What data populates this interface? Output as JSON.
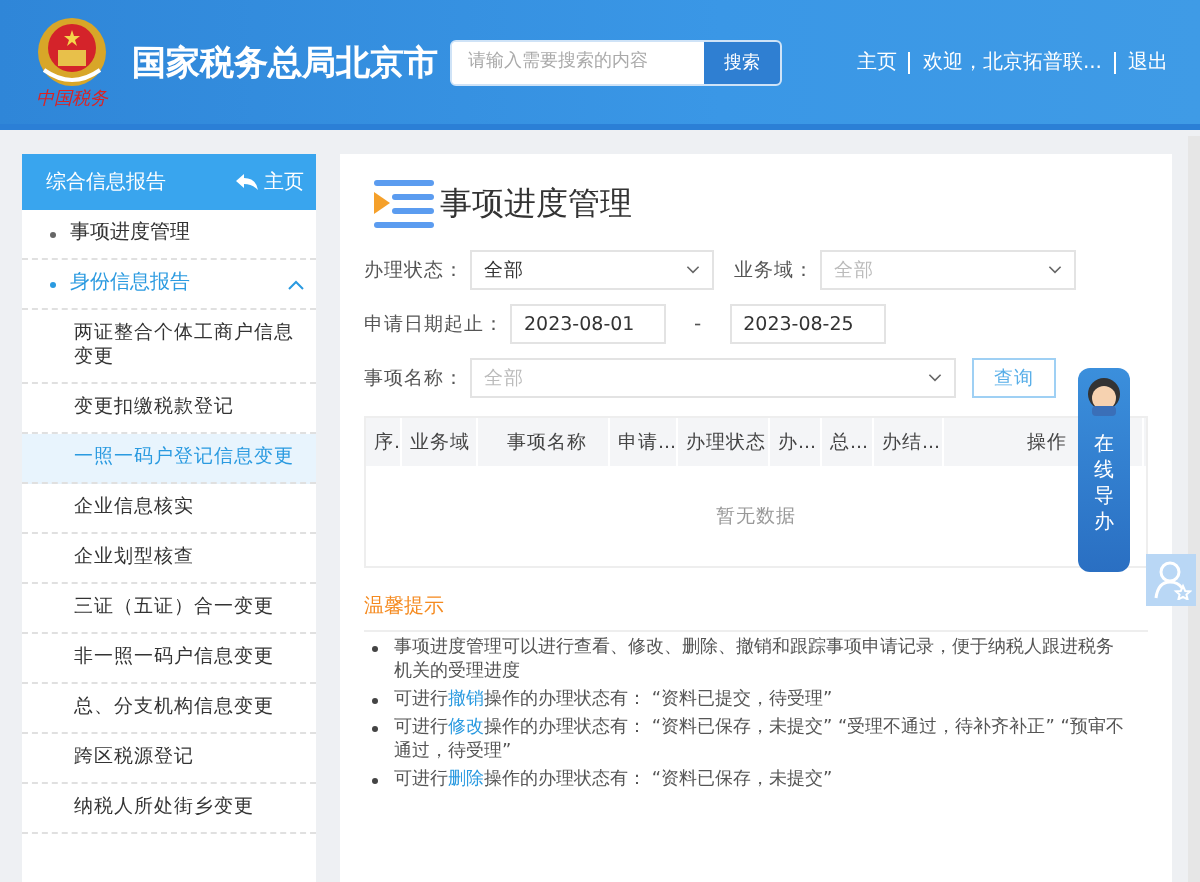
{
  "header": {
    "logo_caption": "中国税务",
    "title": "国家税务总局北京市",
    "search": {
      "placeholder": "请输入需要搜索的内容",
      "button": "搜索"
    },
    "nav": [
      "主页",
      "欢迎，北京拓普联...",
      "退出"
    ]
  },
  "sidebar": {
    "title": "综合信息报告",
    "home_link": "主页",
    "items": [
      {
        "label": "事项进度管理",
        "selected": false
      },
      {
        "label": "身份信息报告",
        "selected": false,
        "expanded": true,
        "children": [
          {
            "label": "两证整合个体工商户信息变更",
            "selected": false
          },
          {
            "label": "变更扣缴税款登记",
            "selected": false
          },
          {
            "label": "一照一码户登记信息变更",
            "selected": true
          },
          {
            "label": "企业信息核实",
            "selected": false
          },
          {
            "label": "企业划型核查",
            "selected": false
          },
          {
            "label": "三证（五证）合一变更",
            "selected": false
          },
          {
            "label": "非一照一码户信息变更",
            "selected": false
          },
          {
            "label": "总、分支机构信息变更",
            "selected": false
          },
          {
            "label": "跨区税源登记",
            "selected": false
          },
          {
            "label": "纳税人所处街乡变更",
            "selected": false
          }
        ]
      }
    ]
  },
  "page_title": "事项进度管理",
  "filters": {
    "status": {
      "label": "办理状态：",
      "value": "全部"
    },
    "domain": {
      "label": "业务域：",
      "placeholder": "全部"
    },
    "date": {
      "label": "申请日期起止：",
      "start": "2023-08-01",
      "separator": "-",
      "end": "2023-08-25"
    },
    "item_name": {
      "label": "事项名称：",
      "placeholder": "全部"
    },
    "query_button": "查询"
  },
  "table": {
    "columns": [
      "序.",
      "业务域",
      "事项名称",
      "申请...",
      "办理状态",
      "办...",
      "总...",
      "办结...",
      "操作"
    ],
    "empty_text": "暂无数据"
  },
  "tips": {
    "title": "温馨提示",
    "items": [
      [
        {
          "kind": "text",
          "text": "事项进度管理可以进行查看、修改、删除、撤销和跟踪事项申请记录，便于纳税人跟进税务机关的受理进度"
        }
      ],
      [
        {
          "kind": "text",
          "text": "可进行"
        },
        {
          "kind": "link",
          "text": "撤销"
        },
        {
          "kind": "text",
          "text": "操作的办理状态有：  “资料已提交，待受理”"
        }
      ],
      [
        {
          "kind": "text",
          "text": "可进行"
        },
        {
          "kind": "link",
          "text": "修改"
        },
        {
          "kind": "text",
          "text": "操作的办理状态有：  “资料已保存，未提交”  “受理不通过，待补齐补正”  “预审不通过，待受理”"
        }
      ],
      [
        {
          "kind": "text",
          "text": "可进行"
        },
        {
          "kind": "link",
          "text": "删除"
        },
        {
          "kind": "text",
          "text": "操作的办理状态有：  “资料已保存，未提交”"
        }
      ]
    ]
  },
  "guide_widget": {
    "label": "在线导办"
  }
}
